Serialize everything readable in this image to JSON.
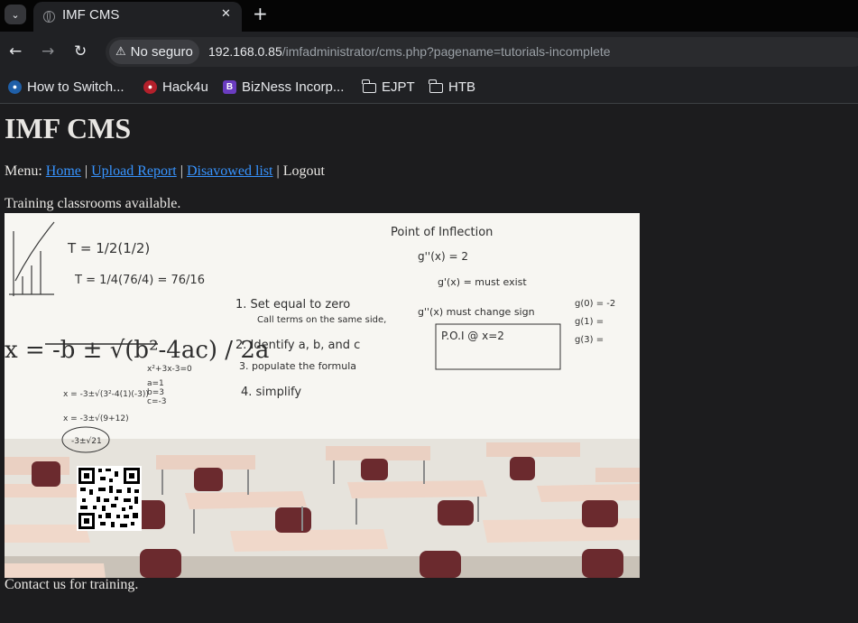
{
  "browser": {
    "tab_title": "IMF CMS",
    "security_label": "No seguro",
    "url_host": "192.168.0.85",
    "url_path": "/imfadministrator/cms.php?pagename=tutorials-incomplete",
    "bookmarks": [
      {
        "label": "How to Switch...",
        "icon": "blue-circle-icon"
      },
      {
        "label": "Hack4u",
        "icon": "red-logo-icon"
      },
      {
        "label": "BizNess Incorp...",
        "icon": "b-letter-icon"
      },
      {
        "label": "EJPT",
        "icon": "folder-icon"
      },
      {
        "label": "HTB",
        "icon": "folder-icon"
      }
    ]
  },
  "page": {
    "title": "IMF CMS",
    "menu_prefix": "Menu:",
    "menu_links": [
      "Home",
      "Upload Report",
      "Disavowed list"
    ],
    "menu_separator": "|",
    "menu_logout": "Logout",
    "intro_text": "Training classrooms available.",
    "image": {
      "board_title": "Point of Inflection",
      "formula_quadratic": "x = -b ± √(b²-4ac) / 2a",
      "steps": [
        "1. Set equal to zero",
        "Call terms on the same side,",
        "2. Identify a, b, and c",
        "3. populate the formula",
        "4. simplify"
      ],
      "notes": [
        "g''(x) = 2",
        "g'(x) = must exist",
        "g''(x) must change sign",
        "P.O.I @ x=2",
        "g(0) = -2",
        "g(1) =",
        "g(3) ="
      ],
      "math_left": [
        "T = 1/2(1/2)",
        "T = 1/4(76/4) = 76/16"
      ],
      "qr_code": "qr-code"
    },
    "footer_text": "Contact us for training."
  },
  "colors": {
    "page_bg": "#1c1c1e",
    "link": "#3794ff",
    "text": "#e8e6e3",
    "chrome_bg": "#202124",
    "tabstrip_bg": "#050505",
    "desk_top": "#e9cdc0",
    "chair": "#6d2a2e",
    "whiteboard": "#f4f3ee"
  }
}
